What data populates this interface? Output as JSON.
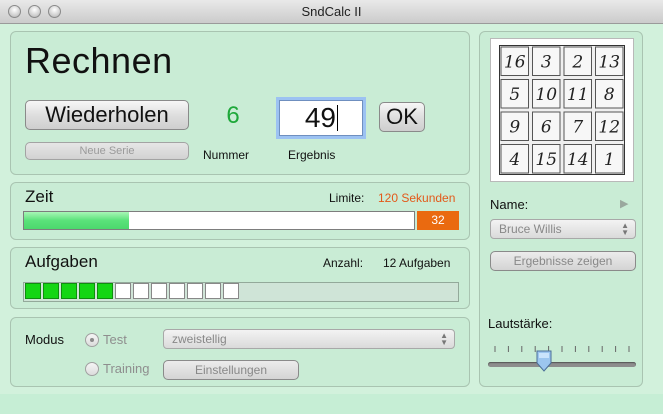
{
  "window": {
    "title": "SndCalc II"
  },
  "calc": {
    "title": "Rechnen",
    "repeat_label": "Wiederholen",
    "new_series_label": "Neue Serie",
    "number_value": "6",
    "number_label": "Nummer",
    "result_value": "49",
    "result_label": "Ergebnis",
    "ok_label": "OK"
  },
  "time": {
    "title": "Zeit",
    "limit_label": "Limite:",
    "limit_value": "120 Sekunden",
    "elapsed": "32",
    "progress_fraction": 0.27,
    "limit_color": "#e3591a",
    "fill_color": "#5ae27a",
    "counter_color": "#ea6a10"
  },
  "tasks": {
    "title": "Aufgaben",
    "count_label": "Anzahl:",
    "count_value": "12 Aufgaben",
    "total": 12,
    "done": 5,
    "done_color": "#14d614"
  },
  "mode": {
    "label": "Modus",
    "option_test": "Test",
    "option_training": "Training",
    "selected": "Test",
    "select_value": "zweistellig",
    "settings_label": "Einstellungen"
  },
  "side": {
    "magic_square": [
      [
        16,
        3,
        2,
        13
      ],
      [
        5,
        10,
        11,
        8
      ],
      [
        9,
        6,
        7,
        12
      ],
      [
        4,
        15,
        14,
        1
      ]
    ],
    "name_label": "Name:",
    "name_value": "Bruce Willis",
    "play_icon": "play-triangle-icon",
    "show_results_label": "Ergebnisse zeigen",
    "volume_label": "Lautstärke:",
    "volume_fraction": 0.38
  }
}
